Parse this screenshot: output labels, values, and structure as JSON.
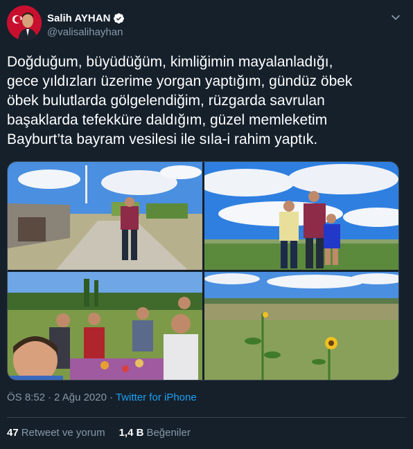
{
  "user": {
    "display_name": "Salih AYHAN",
    "handle": "@valisalihayhan",
    "verified": true
  },
  "tweet": {
    "text": "Doğduğum, büyüdüğüm, kimliğimin mayalanladığı,\ngece yıldızları üzerime yorgan yaptığım, gündüz öbek\nöbek bulutlarda gölgelendiğim, rüzgarda savrulan\nbaşaklarda tefekküre daldığım, güzel memleketim\nBayburt’ta bayram vesilesi ile sıla-i rahim yaptık.",
    "time": "ÖS 8:52",
    "separator": "·",
    "date": "2 Ağu 2020",
    "source": "Twitter for iPhone"
  },
  "stats": {
    "retweets_count": "47",
    "retweets_label": "Retweet ve yorum",
    "likes_count": "1,4 B",
    "likes_label": "Beğeniler"
  },
  "icons": {
    "verified": "verified-badge-icon",
    "more": "chevron-down-icon"
  },
  "colors": {
    "background": "#15202b",
    "accent": "#1da1f2",
    "muted": "#8899a6",
    "border": "#38444d"
  }
}
